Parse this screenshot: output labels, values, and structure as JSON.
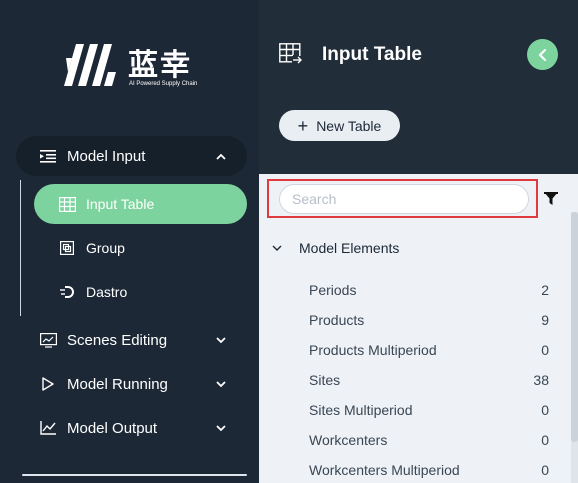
{
  "brand": {
    "name_cn": "蓝幸",
    "tagline": "AI Powered Supply Chain"
  },
  "sidebar": {
    "model_input": {
      "label": "Model Input",
      "icon": "indent-list-icon",
      "expanded": true
    },
    "sub_items": [
      {
        "label": "Input Table",
        "icon": "table-icon",
        "active": true
      },
      {
        "label": "Group",
        "icon": "group-icon",
        "active": false
      },
      {
        "label": "Dastro",
        "icon": "dastro-icon",
        "active": false
      }
    ],
    "scenes_editing": {
      "label": "Scenes Editing",
      "icon": "chart-window-icon"
    },
    "model_running": {
      "label": "Model Running",
      "icon": "play-icon"
    },
    "model_output": {
      "label": "Model Output",
      "icon": "line-chart-icon"
    }
  },
  "header": {
    "title": "Input Table",
    "new_table_label": "New Table"
  },
  "search": {
    "placeholder": "Search",
    "value": ""
  },
  "tree": {
    "group_label": "Model Elements",
    "items": [
      {
        "label": "Periods",
        "count": "2"
      },
      {
        "label": "Products",
        "count": "9"
      },
      {
        "label": "Products Multiperiod",
        "count": "0"
      },
      {
        "label": "Sites",
        "count": "38"
      },
      {
        "label": "Sites Multiperiod",
        "count": "0"
      },
      {
        "label": "Workcenters",
        "count": "0"
      },
      {
        "label": "Workcenters Multiperiod",
        "count": "0"
      }
    ]
  },
  "colors": {
    "accent": "#7dd39e",
    "sidebar_bg": "#1d2836",
    "panel_bg": "#eef2f6",
    "highlight": "#e0393e"
  }
}
